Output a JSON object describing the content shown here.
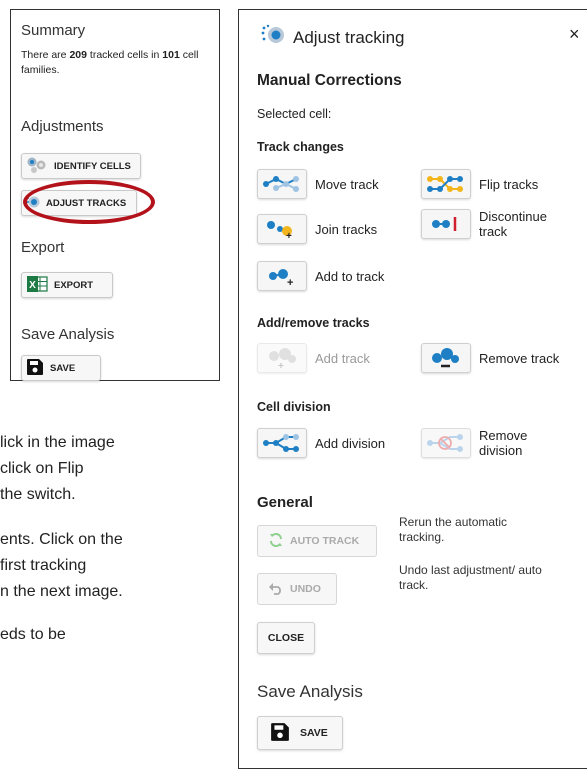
{
  "left_panel": {
    "summary_heading": "Summary",
    "summary_prefix": "There are ",
    "tracked_count": "209",
    "summary_middle": " tracked cells in ",
    "family_count": "101",
    "summary_suffix": " cell families.",
    "adjustments_heading": "Adjustments",
    "identify_cells_label": "IDENTIFY CELLS",
    "adjust_tracks_label": "ADJUST TRACKS",
    "export_heading": "Export",
    "export_label": "EXPORT",
    "save_heading": "Save Analysis",
    "save_label": "SAVE"
  },
  "document_lines": [
    "lick in the image",
    "click on Flip",
    " the switch.",
    "ents. Click on the",
    " first tracking",
    "n the next image.",
    "eds to be"
  ],
  "adjust_panel": {
    "title": "Adjust tracking",
    "close_icon": "×",
    "manual_heading": "Manual Corrections",
    "selected_cell_label": "Selected cell:",
    "track_changes_heading": "Track changes",
    "move_track": "Move track",
    "flip_tracks": "Flip tracks",
    "join_tracks": "Join tracks",
    "discontinue_track": "Discontinue track",
    "add_to_track": "Add to track",
    "add_remove_heading": "Add/remove tracks",
    "add_track": "Add track",
    "remove_track": "Remove track",
    "cell_division_heading": "Cell division",
    "add_division": "Add division",
    "remove_division": "Remove division",
    "general_heading": "General",
    "auto_track_label": "AUTO TRACK",
    "auto_track_desc": "Rerun the automatic tracking.",
    "undo_label": "UNDO",
    "undo_desc": "Undo last adjustment/ auto track.",
    "close_label": "CLOSE",
    "save_heading": "Save Analysis",
    "save_label": "SAVE"
  },
  "colors": {
    "accent_blue": "#1e7fc4",
    "accent_yellow": "#f2b51c",
    "highlight_red": "#b3121b",
    "excel_green": "#1d7a44"
  }
}
